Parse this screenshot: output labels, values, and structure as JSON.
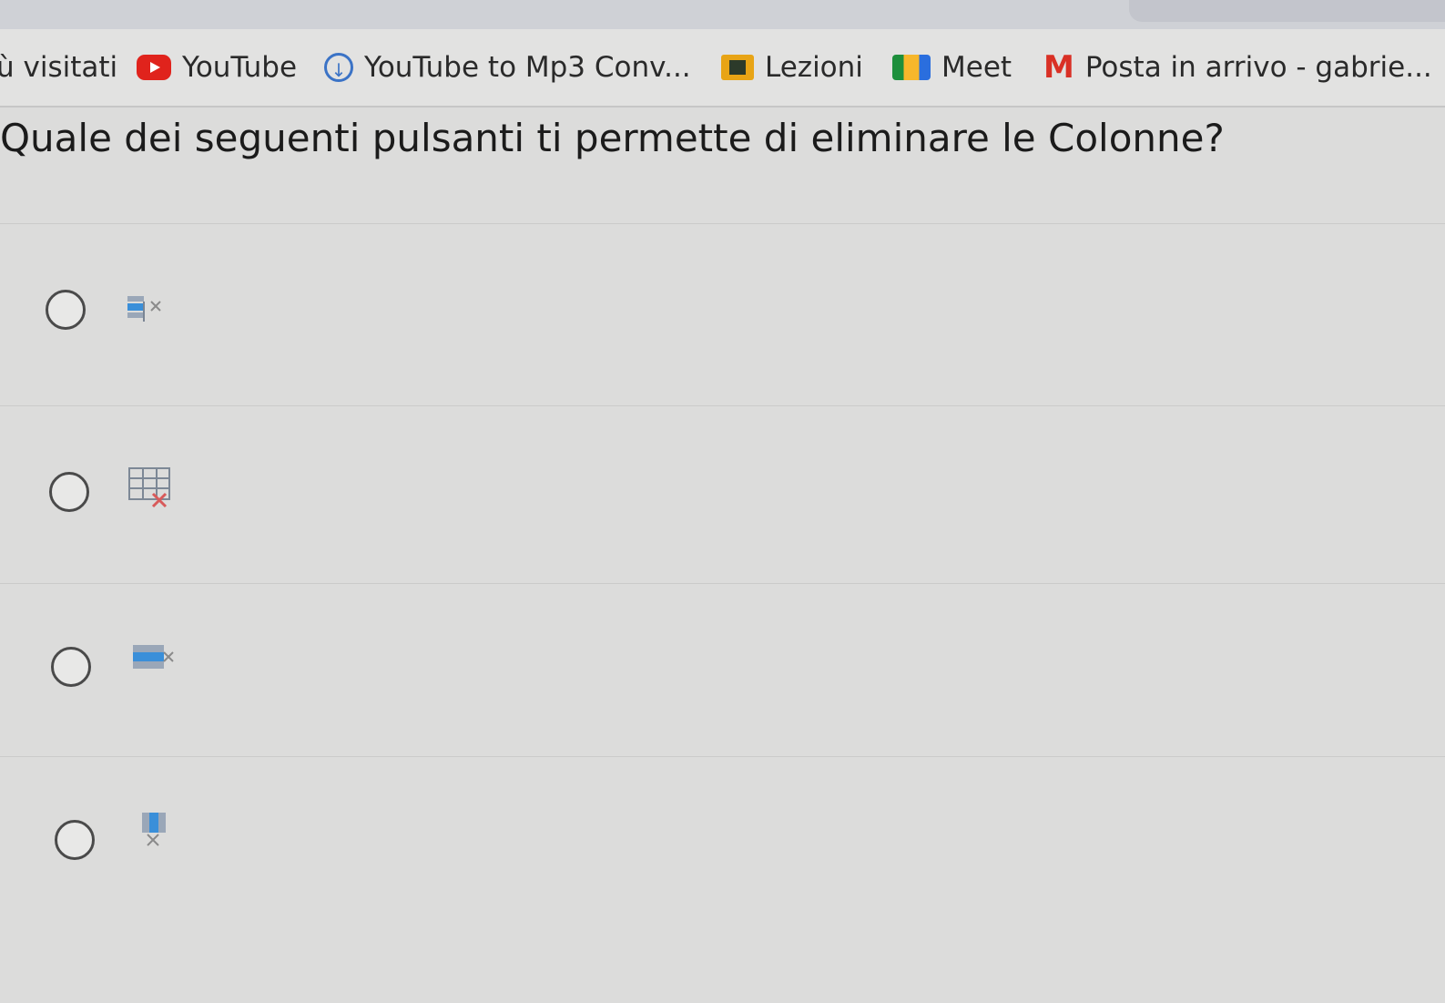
{
  "bookmarks": [
    {
      "label": "ù visitati",
      "icon": "none"
    },
    {
      "label": "YouTube",
      "icon": "youtube-icon"
    },
    {
      "label": "YouTube to Mp3 Conv...",
      "icon": "download-icon"
    },
    {
      "label": "Lezioni",
      "icon": "classroom-icon"
    },
    {
      "label": "Meet",
      "icon": "meet-icon"
    },
    {
      "label": "Posta in arrivo - gabrie...",
      "icon": "gmail-icon"
    }
  ],
  "question": "Quale dei seguenti pulsanti ti permette di eliminare le Colonne?",
  "options": [
    {
      "icon": "delete-cells-icon",
      "selected": false
    },
    {
      "icon": "delete-table-icon",
      "selected": false
    },
    {
      "icon": "delete-rows-icon",
      "selected": false
    },
    {
      "icon": "delete-columns-icon",
      "selected": false
    }
  ],
  "colors": {
    "icon_blue": "#3a8fd9",
    "icon_red": "#d85a5a",
    "background": "#dcdcdb"
  }
}
